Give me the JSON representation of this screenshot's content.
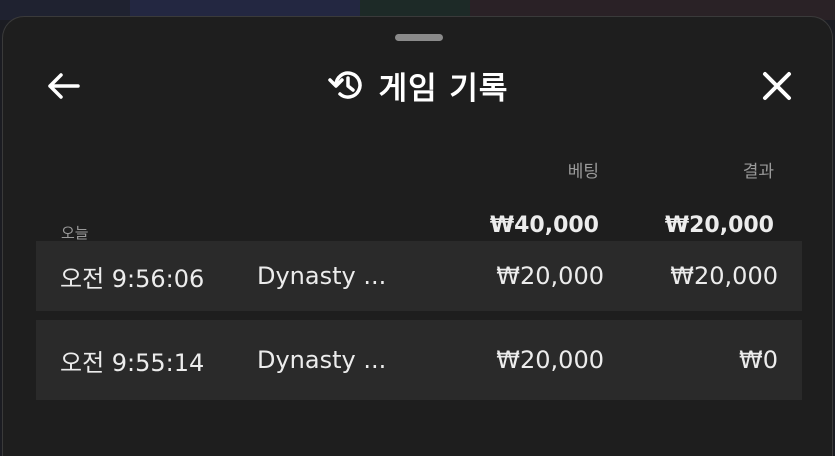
{
  "backdrop": {
    "colors": [
      "#1f2230",
      "#232741",
      "#1d2a27",
      "#2a2126",
      "#2a2226"
    ]
  },
  "header": {
    "title": "게임 기록",
    "back_icon": "arrow-left-icon",
    "history_icon": "history-icon",
    "close_icon": "close-icon"
  },
  "columns": {
    "bet": "베팅",
    "result": "결과"
  },
  "summary": {
    "label": "오늘",
    "total_bet": "₩40,000",
    "total_result": "₩20,000"
  },
  "rows": [
    {
      "time": "오전 9:56:06",
      "game": "Dynasty ...",
      "bet": "₩20,000",
      "result": "₩20,000"
    },
    {
      "time": "오전 9:55:14",
      "game": "Dynasty ...",
      "bet": "₩20,000",
      "result": "₩0"
    }
  ],
  "colors": {
    "sheet": "#1e1e1e",
    "row": "#2a2a2a",
    "muted": "#9a9a9a",
    "text": "#ececec"
  }
}
